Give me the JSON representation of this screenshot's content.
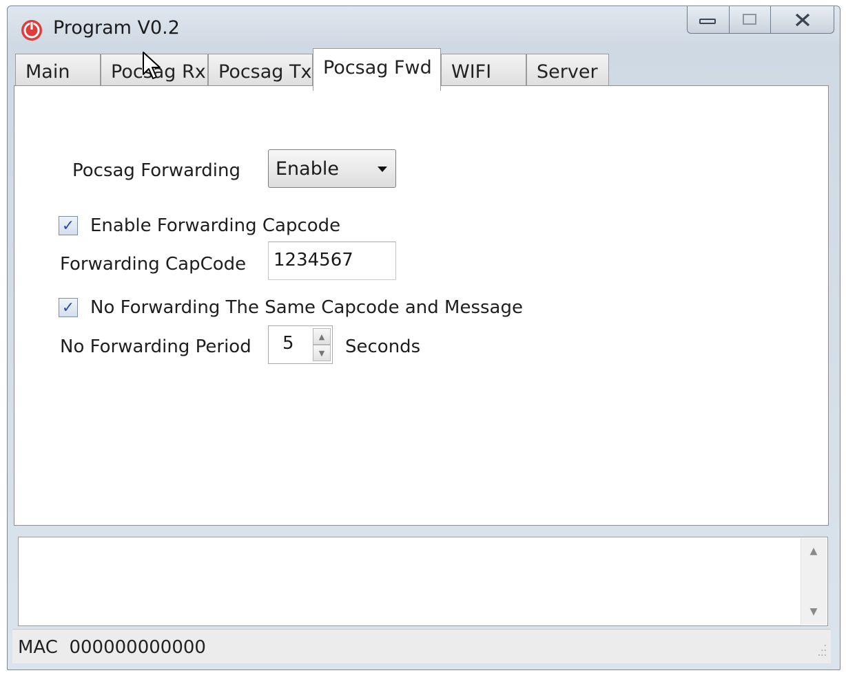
{
  "window": {
    "title": "Program V0.2",
    "icons": {
      "app": "power-icon",
      "minimize": "minimize-icon",
      "maximize": "maximize-icon",
      "close": "close-icon"
    },
    "accent_color": "#d81e1e"
  },
  "tabs": [
    {
      "label": "Main",
      "active": false
    },
    {
      "label": "Pocsag Rx",
      "active": false
    },
    {
      "label": "Pocsag Tx",
      "active": false
    },
    {
      "label": "Pocsag Fwd",
      "active": true
    },
    {
      "label": "WIFI",
      "active": false
    },
    {
      "label": "Server",
      "active": false
    }
  ],
  "fwd": {
    "forwarding_label": "Pocsag Forwarding",
    "forwarding_value": "Enable",
    "enable_capcode_label": "Enable Forwarding Capcode",
    "enable_capcode_checked": true,
    "capcode_label": "Forwarding CapCode",
    "capcode_value": "1234567",
    "no_same_label": "No Forwarding The Same Capcode and Message",
    "no_same_checked": true,
    "period_label": "No Forwarding Period",
    "period_value": "5",
    "period_unit": "Seconds"
  },
  "status": {
    "mac_label": "MAC",
    "mac_value": "000000000000"
  }
}
